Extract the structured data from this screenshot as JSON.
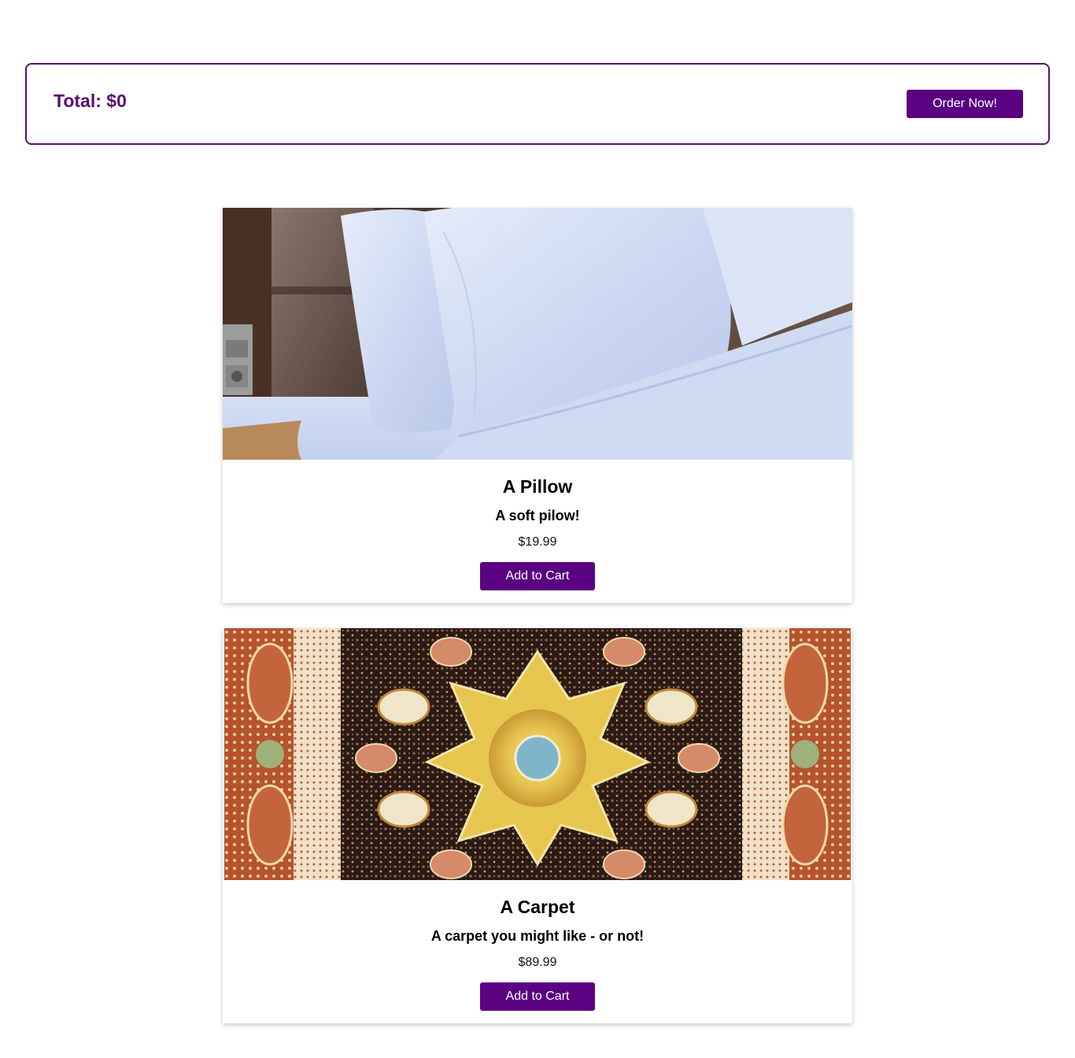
{
  "cart": {
    "total_label": "Total: $0",
    "order_button": "Order Now!"
  },
  "products": [
    {
      "title": "A Pillow",
      "description": "A soft pilow!",
      "price": "$19.99",
      "button": "Add to Cart",
      "image_alt": "pillow-photo"
    },
    {
      "title": "A Carpet",
      "description": "A carpet you might like - or not!",
      "price": "$89.99",
      "button": "Add to Cart",
      "image_alt": "carpet-photo"
    }
  ],
  "colors": {
    "brand": "#5a0081",
    "border": "#5a0f73"
  }
}
